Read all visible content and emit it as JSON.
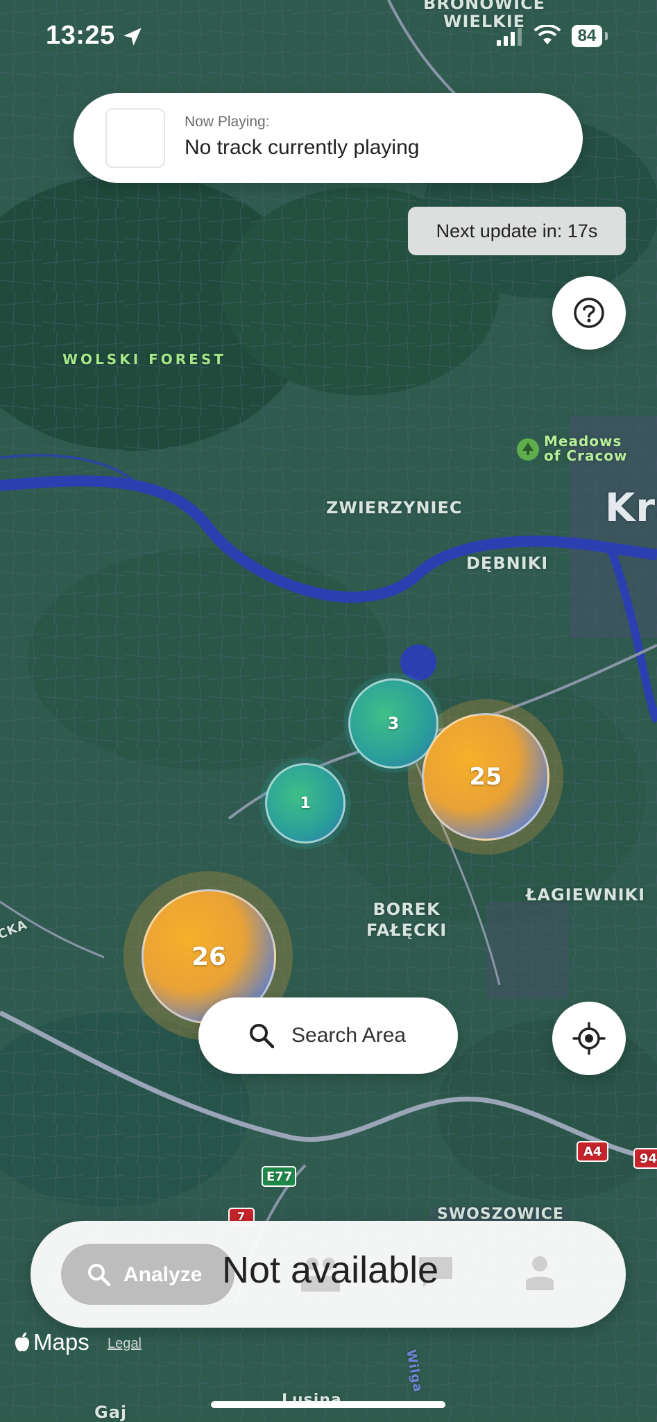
{
  "status_bar": {
    "time": "13:25",
    "battery": "84"
  },
  "now_playing": {
    "label": "Now Playing:",
    "track": "No track currently playing"
  },
  "next_update": "Next update in: 17s",
  "map": {
    "labels": {
      "bronowice": "BRONOWICE\nWIELKIE",
      "wolski_forest": "WOLSKI FOREST",
      "meadows": "Meadows\nof Cracow",
      "krakow_partial": "Kra",
      "zwierzyniec": "ZWIERZYNIEC",
      "debniki": "DĘBNIKI",
      "borek": "BOREK\nFAŁĘCKI",
      "lagiewniki": "ŁAGIEWNIKI",
      "swoszowice": "SWOSZOWICE",
      "cka": "CKA",
      "lusina": "Lusina",
      "gaj": "Gaj",
      "wilga": "Wilga"
    },
    "road_badges": {
      "e77": "E77",
      "a4": "A4",
      "r94": "94",
      "r7": "7"
    },
    "clusters": [
      {
        "count": "3",
        "style": "cool"
      },
      {
        "count": "25",
        "style": "warm"
      },
      {
        "count": "1",
        "style": "cool"
      },
      {
        "count": "26",
        "style": "warm"
      }
    ],
    "colors": {
      "cool": "#2a9e9a",
      "warm": "#f4a72a",
      "road": "#9aa6b8",
      "river": "#2b3fb0"
    }
  },
  "search_area": {
    "label": "Search Area"
  },
  "tabbar": {
    "analyze_label": "Analyze",
    "overlay_text": "Not available",
    "icons": [
      "search-icon",
      "group-icon",
      "chat-icon",
      "person-icon"
    ]
  },
  "attribution": {
    "maps": "Maps",
    "legal": "Legal"
  }
}
